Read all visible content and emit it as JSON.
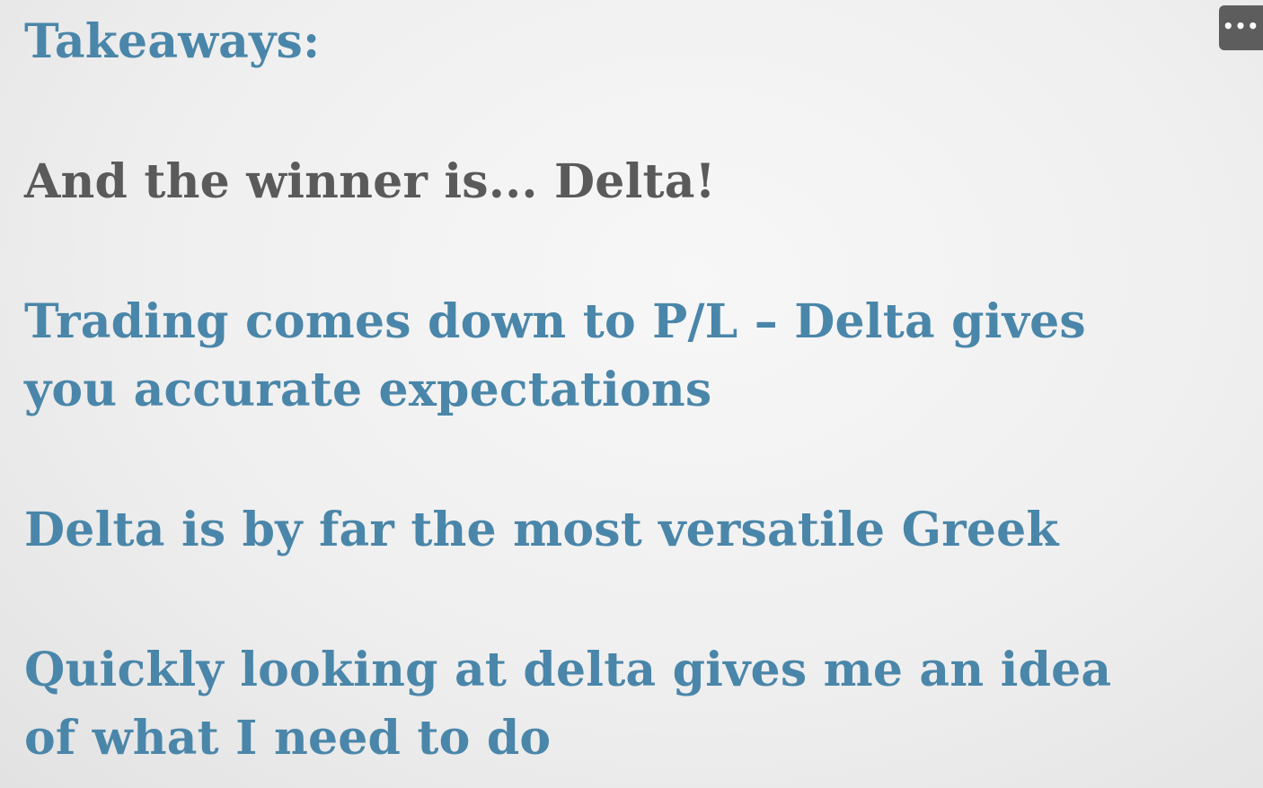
{
  "slide": {
    "title": "Takeaways:",
    "heading": "And the winner is... Delta!",
    "point1_line1": "Trading comes down to P/L – Delta gives",
    "point1_line2": "you accurate expectations",
    "point2": "Delta is by far the most versatile Greek",
    "point3_line1": "Quickly looking at delta gives me an idea",
    "point3_line2": "of what I need to do"
  },
  "menu": {
    "icon": "more-options-icon",
    "glyph": "•••"
  },
  "colors": {
    "accent": "#4a86a9",
    "heading": "#5a5a5a",
    "menu_bg": "#5d5d5d"
  }
}
